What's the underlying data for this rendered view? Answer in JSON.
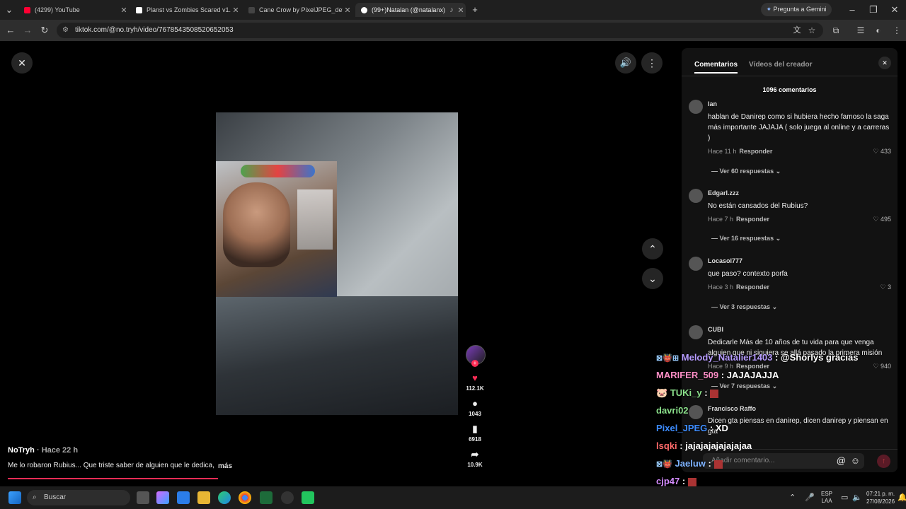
{
  "tabs": [
    {
      "label": "(4299) YouTube",
      "color": "#ff0033"
    },
    {
      "label": "Planst vs Zombies Scared v1.1 |",
      "color": "#ffffff"
    },
    {
      "label": "Cane Crow by PixelJPEG_dev",
      "color": "#222222"
    },
    {
      "label": "(99+)Natalan (@natalanx) |",
      "color": "#ffffff"
    }
  ],
  "gemini_label": "Pregunta a Gemini",
  "url": "tiktok.com/@no.tryh/video/7678543508520652053",
  "video": {
    "author": "NoTryh",
    "time": "· Hace 22 h",
    "caption": "Me lo robaron Rubius... Que triste saber de alguien que le dedica,",
    "more": "más",
    "likes": "112.1K",
    "comments": "1043",
    "saves": "6918",
    "shares": "10.9K"
  },
  "panel": {
    "tab_comments": "Comentarios",
    "tab_creator": "Vídeos del creador",
    "count": "1096 comentarios",
    "comments": [
      {
        "user": "Ian",
        "text": "hablan de Danirep como si hubiera hecho famoso la saga más importante JAJAJA ( solo juega al online y a carreras )",
        "time": "Hace 11 h",
        "reply": "Responder",
        "likes": "433",
        "replies": "Ver 60 respuestas"
      },
      {
        "user": "Edgarl.zzz",
        "text": "No están cansados del Rubius?",
        "time": "Hace 7 h",
        "reply": "Responder",
        "likes": "495",
        "replies": "Ver 16 respuestas"
      },
      {
        "user": "Locasol777",
        "text": "que paso? contexto porfa",
        "time": "Hace 3 h",
        "reply": "Responder",
        "likes": "3",
        "replies": "Ver 3 respuestas"
      },
      {
        "user": "CUBI",
        "text": "Dedicarle Más de 10 años de tu vida para que venga alguien que ni siquiera se allá pasado la primera misión",
        "time": "Hace 9 h",
        "reply": "Responder",
        "likes": "940",
        "replies": "Ver 7 respuestas"
      },
      {
        "user": "Francisco Raffo",
        "text": "Dicen gta piensas en danirep, dicen danirep y piensan en gta",
        "time": "",
        "reply": "",
        "likes": "",
        "replies": ""
      }
    ],
    "input_placeholder": "Añadir comentario..."
  },
  "chat": [
    {
      "user": "Melody_Natalier1403",
      "msg": ": @Shorlys gracias",
      "color": "#b79cff"
    },
    {
      "user": "MARIFER_509",
      "msg": ": JAJAJAJJA",
      "color": "#ff8fc7"
    },
    {
      "user": "TUKi_y",
      "msg": ":",
      "color": "#8be08b"
    },
    {
      "user": "davri02",
      "msg": "",
      "color": "#8be08b"
    },
    {
      "user": "Pixel_JPEG",
      "msg": ": XD",
      "color": "#3d8cff"
    },
    {
      "user": "lsqki",
      "msg": ": jajajajajajajajaa",
      "color": "#ff6b6b"
    },
    {
      "user": "Jaeluw",
      "msg": ":",
      "color": "#7fb3ff"
    },
    {
      "user": "cjp47",
      "msg": ":",
      "color": "#d58cff"
    }
  ],
  "taskbar": {
    "search": "Buscar",
    "lang1": "ESP",
    "lang2": "LAA",
    "time": "07:21 p. m.",
    "date": "27/08/2026"
  }
}
